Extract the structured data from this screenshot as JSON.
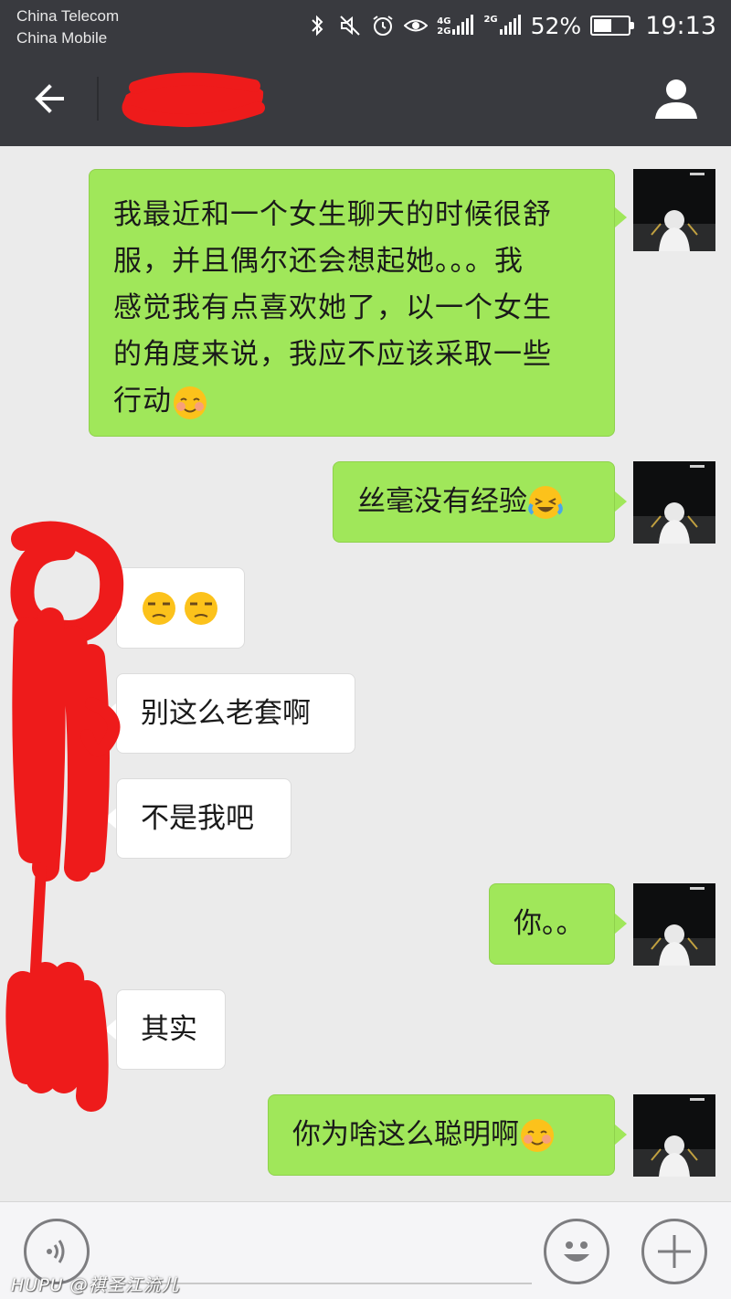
{
  "status_bar": {
    "carrier_1": "China Telecom",
    "carrier_2": "China Mobile",
    "network_1_top": "4G",
    "network_1_bottom": "2G",
    "network_2": "2G",
    "battery_percent": "52%",
    "battery_level": 0.52,
    "time": "19:13",
    "icons": [
      "bluetooth-icon",
      "mute-icon",
      "alarm-icon",
      "eye-icon",
      "signal-icon",
      "battery-icon"
    ]
  },
  "header": {
    "back_icon": "arrow-left-icon",
    "contact_name_redacted": true,
    "profile_icon": "person-icon"
  },
  "messages": [
    {
      "side": "sent",
      "text": "我最近和一个女生聊天的时候很舒服，并且偶尔还会想起她。。。我感觉我有点喜欢她了，以一个女生的角度来说，我应不应该采取一些行动",
      "lines": [
        "我最近和一个女生聊天的时候很舒",
        "服，并且偶尔还会想起她。。。我",
        "感觉我有点喜欢她了，以一个女生",
        "的角度来说，我应不应该采取一些",
        "行动"
      ],
      "emoji": "blushing-smile-emoji"
    },
    {
      "side": "sent",
      "text": "丝毫没有经验",
      "emoji": "laughing-tears-emoji"
    },
    {
      "side": "received",
      "text": "",
      "emoji": "unamused-face-emoji ×2"
    },
    {
      "side": "received",
      "text": "别这么老套啊"
    },
    {
      "side": "received",
      "text": "不是我吧"
    },
    {
      "side": "sent",
      "text": "你。。"
    },
    {
      "side": "received",
      "text": "其实"
    },
    {
      "side": "sent",
      "text": "你为啥这么聪明啊",
      "emoji": "blushing-smile-emoji"
    }
  ],
  "input_bar": {
    "voice_icon": "voice-icon",
    "emoji_icon": "smiley-icon",
    "more_icon": "plus-icon"
  },
  "watermark": "HUPU @祺圣江流儿",
  "colors": {
    "header_bg": "#393a3f",
    "chat_bg": "#ebebeb",
    "sent_bubble": "#a0e75a",
    "received_bubble": "#ffffff",
    "redaction": "#ee1b1b"
  }
}
